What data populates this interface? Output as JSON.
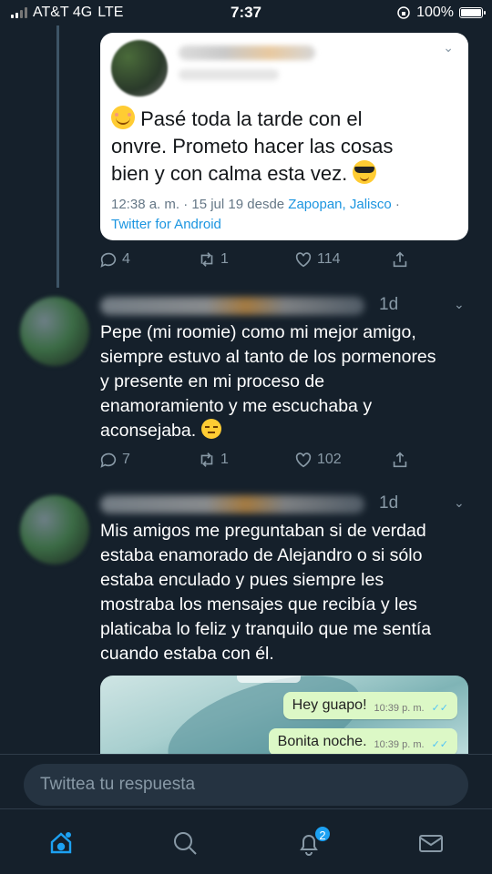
{
  "status_bar": {
    "carrier": "AT&T 4G",
    "network": "LTE",
    "time": "7:37",
    "battery": "100%",
    "battery_level": 1.0
  },
  "quoted_tweet": {
    "text_line_1": "Pasé toda la tarde con el",
    "text_line_2": "onvre. Prometo hacer las cosas",
    "text_line_3": "bien y con calma esta vez.",
    "meta_time": "12:38 a. m. · 15 jul 19 desde ",
    "meta_location": "Zapopan, Jalisco",
    "meta_sep": " ·",
    "meta_client": "Twitter for Android",
    "replies": "4",
    "retweets": "1",
    "likes": "114"
  },
  "tweets": [
    {
      "time": "1d",
      "lines": [
        "Pepe (mi roomie) como mi mejor amigo,",
        "siempre estuvo al tanto de los pormenores",
        "y presente en mi proceso de",
        "enamoramiento y me escuchaba y",
        "aconsejaba."
      ],
      "replies": "7",
      "retweets": "1",
      "likes": "102"
    },
    {
      "time": "1d",
      "lines": [
        "Mis amigos me preguntaban si de verdad",
        "estaba enamorado de Alejandro o si sólo",
        "estaba enculado y pues siempre les",
        "mostraba los mensajes que recibía y les",
        "platicaba lo feliz y tranquilo que me sentía",
        "cuando estaba con él."
      ],
      "image_messages": [
        {
          "text": "Hey guapo!",
          "time": "10:39 p. m."
        },
        {
          "text": "Bonita noche.",
          "time": "10:39 p. m."
        }
      ]
    }
  ],
  "reply": {
    "placeholder": "Twittea tu respuesta"
  },
  "tabbar": {
    "notifications_badge": "2"
  },
  "colors": {
    "background": "#15202b",
    "accent": "#1da1f2",
    "muted": "#8899a6"
  }
}
